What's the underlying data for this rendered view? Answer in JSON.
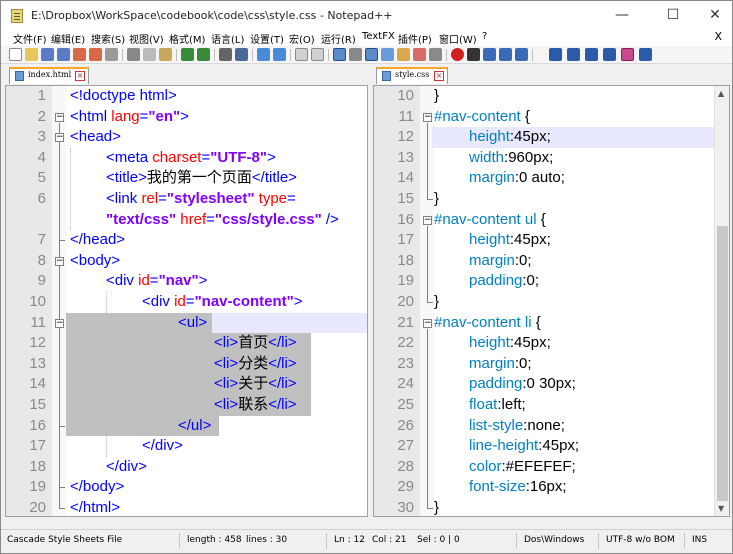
{
  "window": {
    "title": "E:\\Dropbox\\WorkSpace\\codebook\\code\\css\\style.css - Notepad++",
    "minimize": "—",
    "maximize": "☐",
    "close": "✕"
  },
  "menu": {
    "items": [
      "文件(F)",
      "编辑(E)",
      "搜索(S)",
      "视图(V)",
      "格式(M)",
      "语言(L)",
      "设置(T)",
      "宏(O)",
      "运行(R)",
      "TextFX",
      "插件(P)",
      "窗口(W)",
      "?"
    ],
    "close": "X"
  },
  "tabs": {
    "left": "index.html",
    "right": "style.css"
  },
  "left_editor": {
    "lines": [
      {
        "n": "1",
        "parts": [
          [
            "c-tag",
            "<!doctype html>"
          ]
        ]
      },
      {
        "n": "2",
        "parts": [
          [
            "c-tag",
            "<html "
          ],
          [
            "c-attr",
            "lang"
          ],
          [
            "c-tag",
            "="
          ],
          [
            "c-val",
            "\"en\""
          ],
          [
            "c-tag",
            ">"
          ]
        ]
      },
      {
        "n": "3",
        "parts": [
          [
            "c-tag",
            "<head>"
          ]
        ]
      },
      {
        "n": "4",
        "parts": [
          [
            "c-tag",
            "<meta "
          ],
          [
            "c-attr",
            "charset"
          ],
          [
            "c-tag",
            "="
          ],
          [
            "c-val",
            "\"UTF-8\""
          ],
          [
            "c-tag",
            ">"
          ]
        ]
      },
      {
        "n": "5",
        "parts": [
          [
            "c-tag",
            "<title>"
          ],
          [
            "c-txt",
            "我的第一个页面"
          ],
          [
            "c-tag",
            "</title>"
          ]
        ]
      },
      {
        "n": "6",
        "parts": [
          [
            "c-tag",
            "<link "
          ],
          [
            "c-attr",
            "rel"
          ],
          [
            "c-tag",
            "="
          ],
          [
            "c-val",
            "\"stylesheet\""
          ],
          [
            "c-attr",
            " type"
          ],
          [
            "c-tag",
            "="
          ]
        ]
      },
      {
        "n": "",
        "parts": [
          [
            "c-val",
            "\"text/css\""
          ],
          [
            "c-attr",
            " href"
          ],
          [
            "c-tag",
            "="
          ],
          [
            "c-val",
            "\"css/style.css\""
          ],
          [
            "c-tag",
            " />"
          ]
        ]
      },
      {
        "n": "7",
        "parts": [
          [
            "c-tag",
            "</head>"
          ]
        ]
      },
      {
        "n": "8",
        "parts": [
          [
            "c-tag",
            "<body>"
          ]
        ]
      },
      {
        "n": "9",
        "parts": [
          [
            "c-tag",
            "<div "
          ],
          [
            "c-attr",
            "id"
          ],
          [
            "c-tag",
            "="
          ],
          [
            "c-val",
            "\"nav\""
          ],
          [
            "c-tag",
            ">"
          ]
        ]
      },
      {
        "n": "10",
        "parts": [
          [
            "c-tag",
            "<div "
          ],
          [
            "c-attr",
            "id"
          ],
          [
            "c-tag",
            "="
          ],
          [
            "c-val",
            "\"nav-content\""
          ],
          [
            "c-tag",
            ">"
          ]
        ]
      },
      {
        "n": "11",
        "parts": [
          [
            "c-tag",
            "<ul>"
          ]
        ]
      },
      {
        "n": "12",
        "parts": [
          [
            "c-tag",
            "<li>"
          ],
          [
            "c-txt",
            "首页"
          ],
          [
            "c-tag",
            "</li>"
          ]
        ]
      },
      {
        "n": "13",
        "parts": [
          [
            "c-tag",
            "<li>"
          ],
          [
            "c-txt",
            "分类"
          ],
          [
            "c-tag",
            "</li>"
          ]
        ]
      },
      {
        "n": "14",
        "parts": [
          [
            "c-tag",
            "<li>"
          ],
          [
            "c-txt",
            "关于"
          ],
          [
            "c-tag",
            "</li>"
          ]
        ]
      },
      {
        "n": "15",
        "parts": [
          [
            "c-tag",
            "<li>"
          ],
          [
            "c-txt",
            "联系"
          ],
          [
            "c-tag",
            "</li>"
          ]
        ]
      },
      {
        "n": "16",
        "parts": [
          [
            "c-tag",
            "</ul>"
          ]
        ]
      },
      {
        "n": "17",
        "parts": [
          [
            "c-tag",
            "</div>"
          ]
        ]
      },
      {
        "n": "18",
        "parts": [
          [
            "c-tag",
            "</div>"
          ]
        ]
      },
      {
        "n": "19",
        "parts": [
          [
            "c-tag",
            "</body>"
          ]
        ]
      },
      {
        "n": "20",
        "parts": [
          [
            "c-tag",
            "</html>"
          ]
        ]
      }
    ]
  },
  "right_editor": {
    "lines": [
      {
        "n": "10",
        "parts": [
          [
            "c-brace",
            "}"
          ]
        ]
      },
      {
        "n": "11",
        "parts": [
          [
            "c-selid",
            "#nav-content "
          ],
          [
            "c-brace",
            "{"
          ]
        ]
      },
      {
        "n": "12",
        "parts": [
          [
            "c-prop",
            "height"
          ],
          [
            "c-colon",
            ":45px;"
          ]
        ]
      },
      {
        "n": "13",
        "parts": [
          [
            "c-prop",
            "width"
          ],
          [
            "c-colon",
            ":960px;"
          ]
        ]
      },
      {
        "n": "14",
        "parts": [
          [
            "c-prop",
            "margin"
          ],
          [
            "c-colon",
            ":0 auto;"
          ]
        ]
      },
      {
        "n": "15",
        "parts": [
          [
            "c-brace",
            "}"
          ]
        ]
      },
      {
        "n": "16",
        "parts": [
          [
            "c-selid",
            "#nav-content ul "
          ],
          [
            "c-brace",
            "{"
          ]
        ]
      },
      {
        "n": "17",
        "parts": [
          [
            "c-prop",
            "height"
          ],
          [
            "c-colon",
            ":45px;"
          ]
        ]
      },
      {
        "n": "18",
        "parts": [
          [
            "c-prop",
            "margin"
          ],
          [
            "c-colon",
            ":0;"
          ]
        ]
      },
      {
        "n": "19",
        "parts": [
          [
            "c-prop",
            "padding"
          ],
          [
            "c-colon",
            ":0;"
          ]
        ]
      },
      {
        "n": "20",
        "parts": [
          [
            "c-brace",
            "}"
          ]
        ]
      },
      {
        "n": "21",
        "parts": [
          [
            "c-selid",
            "#nav-content li "
          ],
          [
            "c-brace",
            "{"
          ]
        ]
      },
      {
        "n": "22",
        "parts": [
          [
            "c-prop",
            "height"
          ],
          [
            "c-colon",
            ":45px;"
          ]
        ]
      },
      {
        "n": "23",
        "parts": [
          [
            "c-prop",
            "margin"
          ],
          [
            "c-colon",
            ":0;"
          ]
        ]
      },
      {
        "n": "24",
        "parts": [
          [
            "c-prop",
            "padding"
          ],
          [
            "c-colon",
            ":0 30px;"
          ]
        ]
      },
      {
        "n": "25",
        "parts": [
          [
            "c-prop",
            "float"
          ],
          [
            "c-colon",
            ":left;"
          ]
        ]
      },
      {
        "n": "26",
        "parts": [
          [
            "c-prop",
            "list-style"
          ],
          [
            "c-colon",
            ":none;"
          ]
        ]
      },
      {
        "n": "27",
        "parts": [
          [
            "c-prop",
            "line-height"
          ],
          [
            "c-colon",
            ":45px;"
          ]
        ]
      },
      {
        "n": "28",
        "parts": [
          [
            "c-prop",
            "color"
          ],
          [
            "c-colon",
            ":#EFEFEF;"
          ]
        ]
      },
      {
        "n": "29",
        "parts": [
          [
            "c-prop",
            "font-size"
          ],
          [
            "c-colon",
            ":16px;"
          ]
        ]
      },
      {
        "n": "30",
        "parts": [
          [
            "c-brace",
            "}"
          ]
        ]
      }
    ]
  },
  "status": {
    "file_type": "Cascade Style Sheets File",
    "length": "length : 458",
    "lines": "lines : 30",
    "ln": "Ln : 12",
    "col": "Col : 21",
    "sel": "Sel : 0 | 0",
    "eol": "Dos\\Windows",
    "encoding": "UTF-8 w/o BOM",
    "mode": "INS"
  },
  "colors": {
    "tag": "#0000ff",
    "attribute": "#ff0000",
    "value": "#8000ff",
    "css_selector": "#0080c0",
    "css_property": "#0080c0",
    "current_line": "#e8e8ff",
    "selection": "#c0c0c0",
    "active_tab": "#f9a526"
  }
}
